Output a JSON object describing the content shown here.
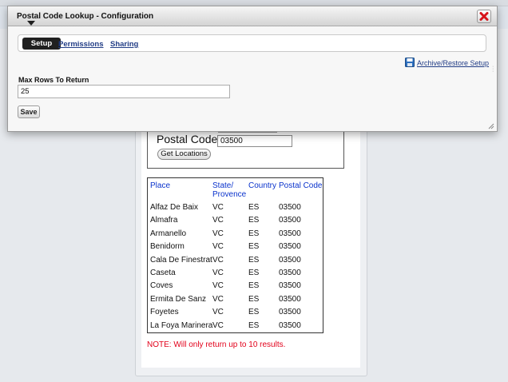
{
  "dialog": {
    "title": "Postal Code Lookup - Configuration",
    "tabs": [
      {
        "label": "Setup",
        "active": true
      },
      {
        "label": "Permissions",
        "active": false
      },
      {
        "label": "Sharing",
        "active": false
      }
    ],
    "archive_link": "Archive/Restore Setup",
    "max_rows_label": "Max Rows To Return",
    "max_rows_value": "25",
    "save_label": "Save",
    "close_icon": "close-icon",
    "close_color": "#d7141a"
  },
  "lookup": {
    "postal_code_label": "Postal Code",
    "postal_code_value": "03500",
    "get_locations_label": "Get Locations"
  },
  "results": {
    "headers": {
      "place": "Place",
      "state_line1": "State/",
      "state_line2": "Provence",
      "country": "Country",
      "postal_code": "Postal Code"
    },
    "rows": [
      {
        "place": "Alfaz De Baix",
        "state": "VC",
        "country": "ES",
        "postal_code": "03500"
      },
      {
        "place": "Almafra",
        "state": "VC",
        "country": "ES",
        "postal_code": "03500"
      },
      {
        "place": "Armanello",
        "state": "VC",
        "country": "ES",
        "postal_code": "03500"
      },
      {
        "place": "Benidorm",
        "state": "VC",
        "country": "ES",
        "postal_code": "03500"
      },
      {
        "place": "Cala De Finestrat",
        "state": "VC",
        "country": "ES",
        "postal_code": "03500"
      },
      {
        "place": "Caseta",
        "state": "VC",
        "country": "ES",
        "postal_code": "03500"
      },
      {
        "place": "Coves",
        "state": "VC",
        "country": "ES",
        "postal_code": "03500"
      },
      {
        "place": "Ermita De Sanz",
        "state": "VC",
        "country": "ES",
        "postal_code": "03500"
      },
      {
        "place": "Foyetes",
        "state": "VC",
        "country": "ES",
        "postal_code": "03500"
      },
      {
        "place": "La Foya Marinera",
        "state": "VC",
        "country": "ES",
        "postal_code": "03500"
      }
    ],
    "note": "NOTE: Will only return up to 10 results.",
    "header_color": "#0a33cc",
    "note_color": "#e2001a"
  }
}
